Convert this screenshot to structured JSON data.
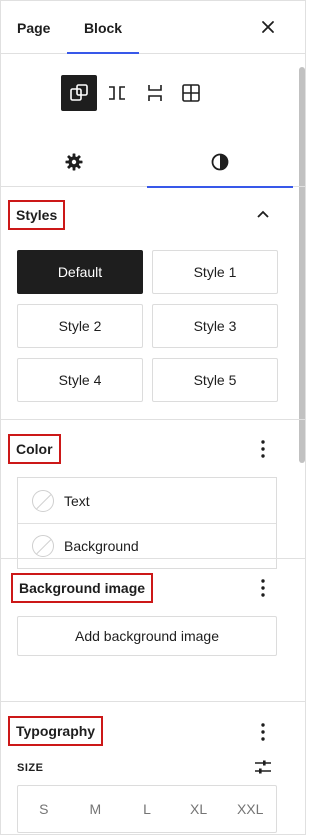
{
  "header": {
    "tabs": [
      {
        "label": "Page"
      },
      {
        "label": "Block"
      }
    ],
    "close_icon": "close-icon"
  },
  "block_variations": [
    {
      "icon": "group-icon",
      "active": true
    },
    {
      "icon": "row-icon",
      "active": false
    },
    {
      "icon": "stack-icon",
      "active": false
    },
    {
      "icon": "grid-icon",
      "active": false
    }
  ],
  "inspector_tabs": [
    {
      "icon": "gear-icon",
      "active": false
    },
    {
      "icon": "half-circle-icon",
      "active": true
    }
  ],
  "styles": {
    "title": "Styles",
    "toggle_icon": "chevron-up-icon",
    "buttons": [
      {
        "label": "Default",
        "active": true
      },
      {
        "label": "Style 1",
        "active": false
      },
      {
        "label": "Style 2",
        "active": false
      },
      {
        "label": "Style 3",
        "active": false
      },
      {
        "label": "Style 4",
        "active": false
      },
      {
        "label": "Style 5",
        "active": false
      }
    ]
  },
  "color": {
    "title": "Color",
    "menu_icon": "more-vertical-icon",
    "items": [
      {
        "label": "Text"
      },
      {
        "label": "Background"
      }
    ]
  },
  "background_image": {
    "title": "Background image",
    "menu_icon": "more-vertical-icon",
    "button_label": "Add background image"
  },
  "typography": {
    "title": "Typography",
    "menu_icon": "more-vertical-icon",
    "size_label": "SIZE",
    "size_settings_icon": "sliders-icon",
    "size_options": [
      "S",
      "M",
      "L",
      "XL",
      "XXL"
    ]
  },
  "colors": {
    "accent": "#3858e9",
    "highlight_border": "#cc1818",
    "active_bg": "#1e1e1e"
  }
}
